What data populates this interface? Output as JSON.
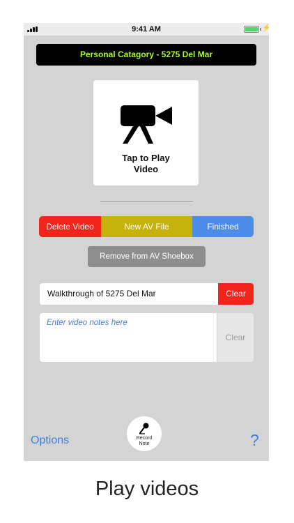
{
  "status_bar": {
    "time": "9:41 AM",
    "signal_icon": "signal-bars-icon",
    "battery_icon": "battery-charging-icon",
    "battery_color": "#4cd964"
  },
  "header": {
    "title": "Personal Catagory - 5275 Del Mar",
    "title_color": "#a8ff1e"
  },
  "video_tile": {
    "icon": "video-camera-icon",
    "label_line1": "Tap to Play",
    "label_line2": "Video"
  },
  "segmented_control": {
    "delete_label": "Delete Video",
    "delete_color": "#f0261c",
    "new_label": "New AV File",
    "new_color": "#c5b20a",
    "finished_label": "Finished",
    "finished_color": "#4d8ce9"
  },
  "remove_button": {
    "label": "Remove from AV Shoebox"
  },
  "title_field": {
    "value": "Walkthrough of 5275 Del Mar",
    "clear_label": "Clear"
  },
  "notes_field": {
    "placeholder": "Enter video notes here",
    "clear_label": "Clear"
  },
  "bottom_bar": {
    "options_label": "Options",
    "record_icon": "microphone-icon",
    "record_label_line1": "Record",
    "record_label_line2": "Note",
    "help_label": "?"
  },
  "caption": "Play videos"
}
